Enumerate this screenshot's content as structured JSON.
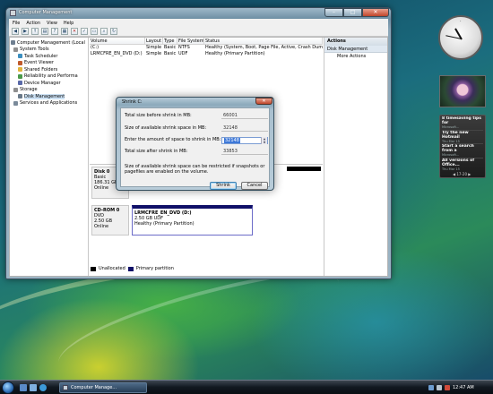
{
  "window": {
    "title": "Computer Management",
    "menu": [
      "File",
      "Action",
      "View",
      "Help"
    ]
  },
  "tree": [
    {
      "label": "Computer Management (Local",
      "indent": 0,
      "color": "#6f7f90"
    },
    {
      "label": "System Tools",
      "indent": 1,
      "color": "#8f8f8f"
    },
    {
      "label": "Task Scheduler",
      "indent": 2,
      "color": "#3c8fc0"
    },
    {
      "label": "Event Viewer",
      "indent": 2,
      "color": "#c05a2c"
    },
    {
      "label": "Shared Folders",
      "indent": 2,
      "color": "#e1b43c"
    },
    {
      "label": "Reliability and Performa",
      "indent": 2,
      "color": "#4a9a4a"
    },
    {
      "label": "Device Manager",
      "indent": 2,
      "color": "#5a6aa8"
    },
    {
      "label": "Storage",
      "indent": 1,
      "color": "#8f8f8f"
    },
    {
      "label": "Disk Management",
      "indent": 2,
      "color": "#6a7a8a",
      "selected": true
    },
    {
      "label": "Services and Applications",
      "indent": 1,
      "color": "#7a8a9a"
    }
  ],
  "volumes": {
    "headers": [
      "Volume",
      "Layout",
      "Type",
      "File System",
      "Status"
    ],
    "rows": [
      [
        "(C:)",
        "Simple",
        "Basic",
        "NTFS",
        "Healthy (System, Boot, Page File, Active, Crash Dump, P"
      ],
      [
        "LRMCFRE_EN_DVD (D:)",
        "Simple",
        "Basic",
        "UDF",
        "Healthy (Primary Partition)"
      ]
    ]
  },
  "disks": [
    {
      "name": "Disk 0",
      "type": "Basic",
      "size": "186.31 GB",
      "state": "Online"
    },
    {
      "name": "CD-ROM 0",
      "type": "DVD",
      "size": "2.50 GB",
      "state": "Online"
    }
  ],
  "cd_partition": {
    "label": "LRMCFRE_EN_DVD (D:)",
    "size": "2.50 GB UDF",
    "status": "Healthy (Primary Partition)"
  },
  "legend": {
    "unallocated": "Unallocated",
    "primary": "Primary partition",
    "unallocated_color": "#000000",
    "primary_color": "#101068"
  },
  "actions": {
    "header": "Actions",
    "section": "Disk Management",
    "more": "More Actions"
  },
  "dialog": {
    "title": "Shrink C:",
    "total_label": "Total size before shrink in MB:",
    "total_value": "66001",
    "available_label": "Size of available shrink space in MB:",
    "available_value": "32148",
    "amount_label": "Enter the amount of space to shrink in MB:",
    "amount_value": "32148",
    "after_label": "Total size after shrink in MB:",
    "after_value": "33853",
    "note": "Size of available shrink space can be restricted if snapshots or pagefiles are enabled on the volume.",
    "shrink_btn": "Shrink",
    "cancel_btn": "Cancel"
  },
  "feeds": [
    {
      "title": "8 timesaving tips for",
      "source": "Microsoft..."
    },
    {
      "title": "Try the new Hotmail",
      "source": "Thu Mar 15"
    },
    {
      "title": "Start a search from a",
      "source": "Microsoft..."
    },
    {
      "title": "All versions of Office...",
      "source": "Thu Mar 15"
    }
  ],
  "feed_nav": "17-20",
  "taskbar": {
    "task": "Computer Manage...",
    "clock": "12:47 AM"
  },
  "icons": {
    "start": "windows-orb-icon",
    "close": "close-icon",
    "clock_gadget": "analog-clock-icon"
  }
}
